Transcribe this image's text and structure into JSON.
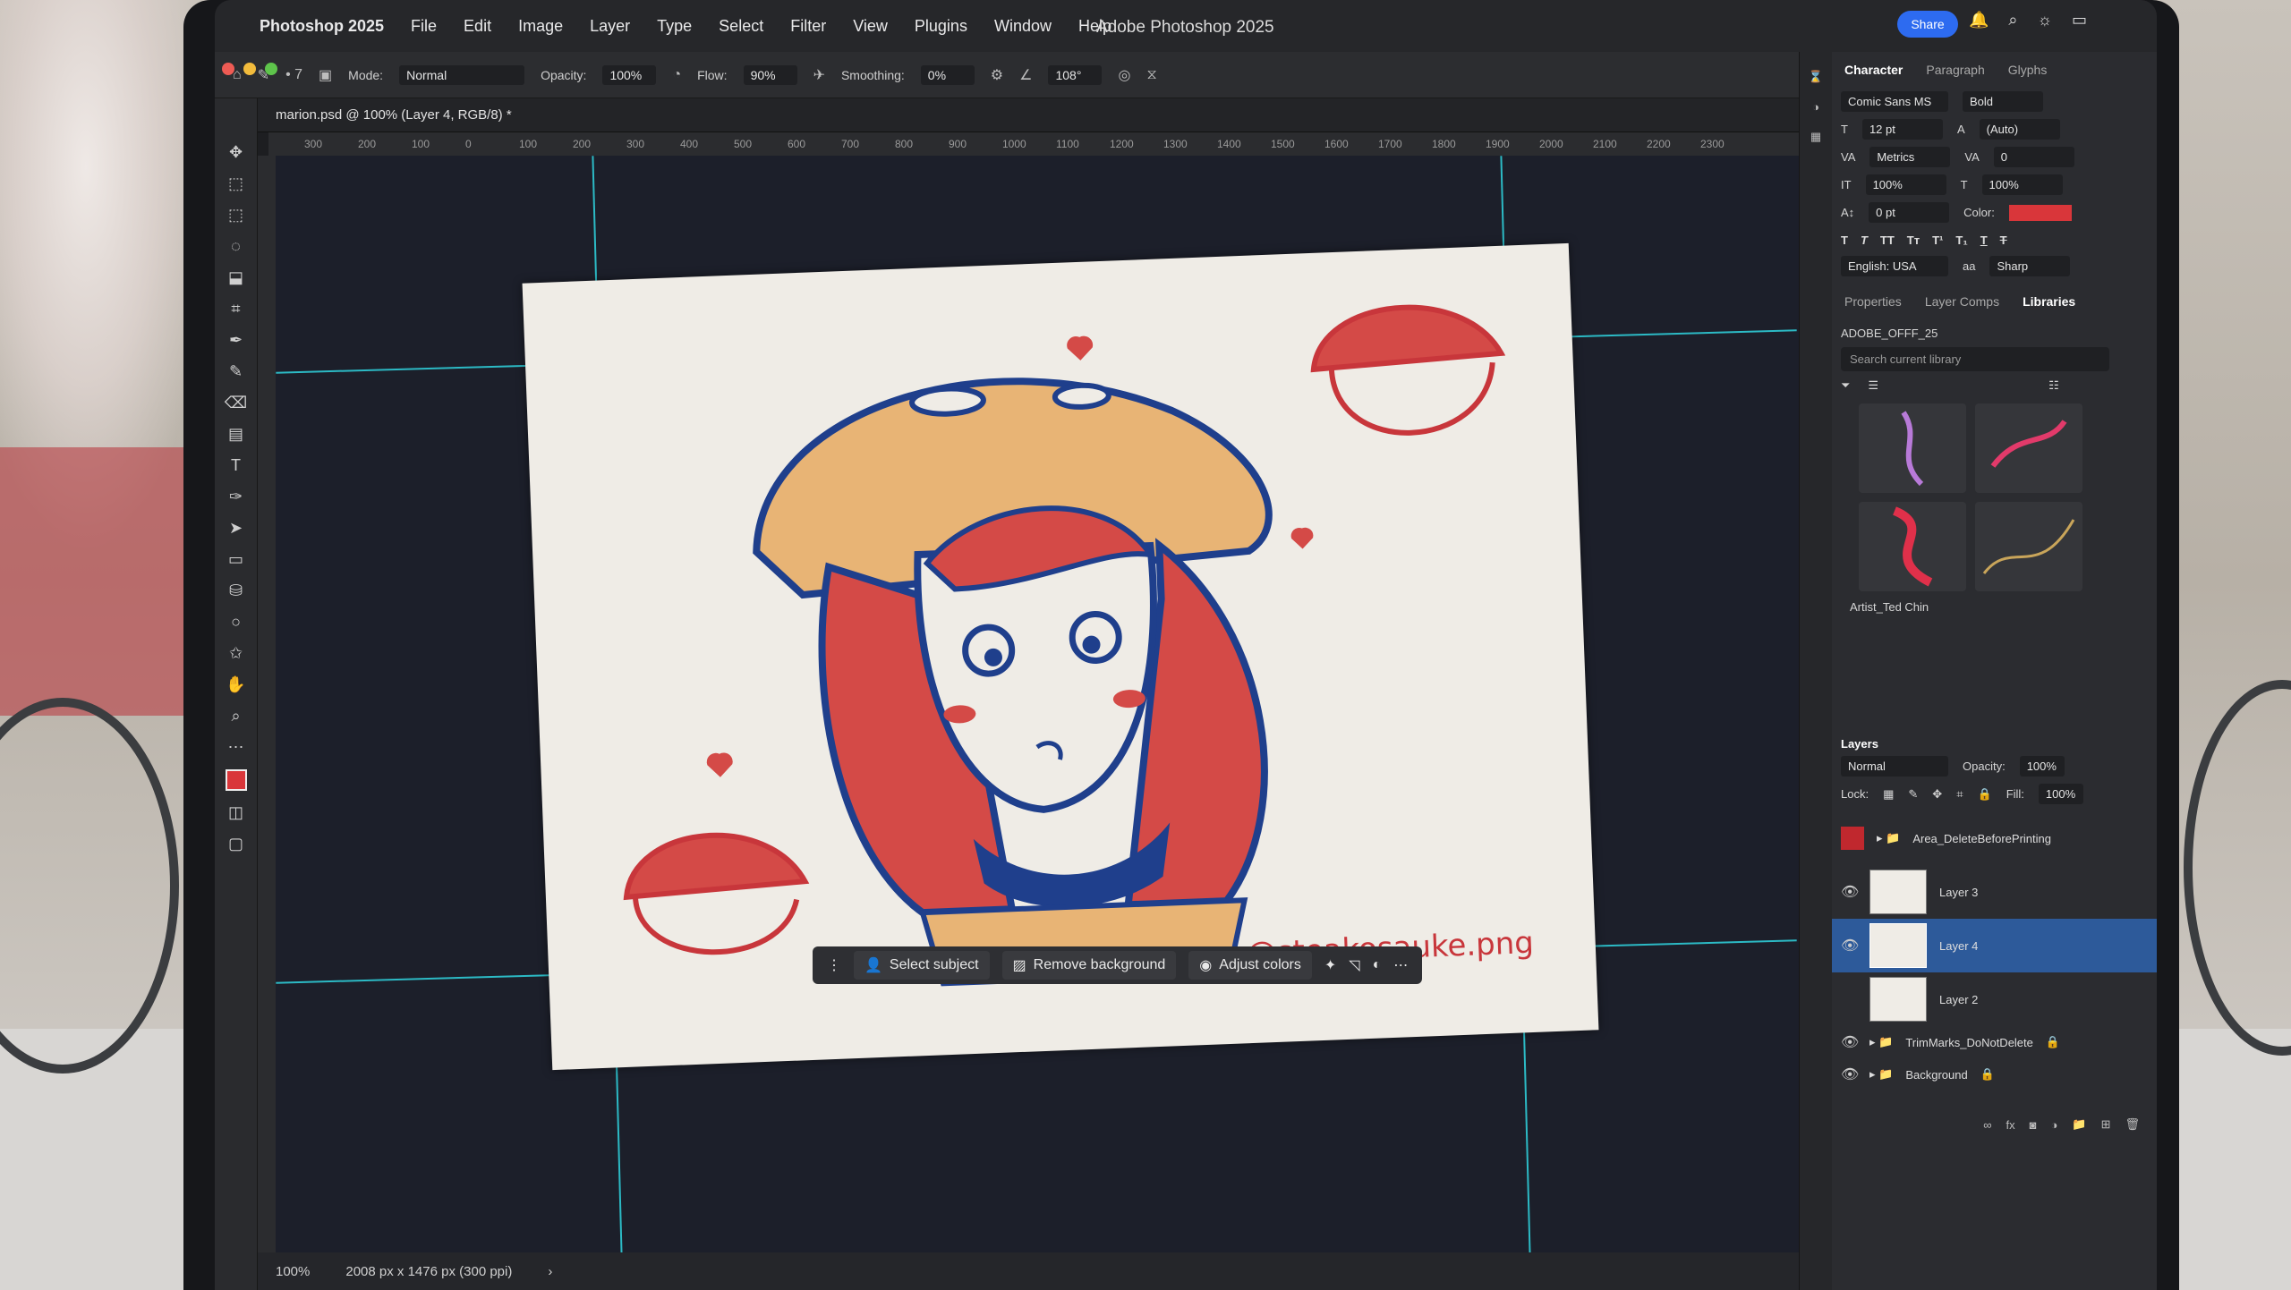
{
  "menubar": {
    "app_name": "Photoshop 2025",
    "items": [
      "File",
      "Edit",
      "Image",
      "Layer",
      "Type",
      "Select",
      "Filter",
      "View",
      "Plugins",
      "Window",
      "Help"
    ],
    "window_title": "Adobe Photoshop 2025",
    "share_label": "Share"
  },
  "options": {
    "mode_label": "Mode:",
    "mode_value": "Normal",
    "opacity_label": "Opacity:",
    "opacity_value": "100%",
    "flow_label": "Flow:",
    "flow_value": "90%",
    "smoothing_label": "Smoothing:",
    "smoothing_value": "0%",
    "angle_value": "108°"
  },
  "document": {
    "tab_title": "marion.psd @ 100% (Layer 4, RGB/8) *",
    "signature": "@steakosauke.png",
    "ruler_ticks": [
      "300",
      "200",
      "100",
      "0",
      "100",
      "200",
      "300",
      "400",
      "500",
      "600",
      "700",
      "800",
      "900",
      "1000",
      "1100",
      "1200",
      "1300",
      "1400",
      "1500",
      "1600",
      "1700",
      "1800",
      "1900",
      "2000",
      "2100",
      "2200",
      "2300"
    ]
  },
  "taskbar": {
    "select_subject": "Select subject",
    "remove_background": "Remove background",
    "adjust_colors": "Adjust colors"
  },
  "status": {
    "zoom": "100%",
    "dimensions": "2008 px x 1476 px (300 ppi)"
  },
  "character": {
    "tabs": [
      "Character",
      "Paragraph",
      "Glyphs"
    ],
    "font_family": "Comic Sans MS",
    "font_style": "Bold",
    "font_size": "12 pt",
    "leading": "(Auto)",
    "kerning": "Metrics",
    "tracking": "0",
    "vertical_scale": "100%",
    "horizontal_scale": "100%",
    "baseline": "0 pt",
    "color_label": "Color:",
    "color_hex": "#d9363a",
    "language": "English: USA",
    "anti_alias": "Sharp"
  },
  "libraries": {
    "tabs": [
      "Properties",
      "Layer Comps",
      "Libraries"
    ],
    "library_name": "ADOBE_OFFF_25",
    "search_placeholder": "Search current library",
    "group_name": "Artist_Ted Chin"
  },
  "layers": {
    "title": "Layers",
    "blend_mode": "Normal",
    "opacity_label": "Opacity:",
    "opacity_value": "100%",
    "lock_label": "Lock:",
    "fill_label": "Fill:",
    "fill_value": "100%",
    "rows": [
      "Area_DeleteBeforePrinting",
      "Layer 3",
      "Layer 4",
      "Layer 2",
      "TrimMarks_DoNotDelete",
      "Background"
    ]
  }
}
